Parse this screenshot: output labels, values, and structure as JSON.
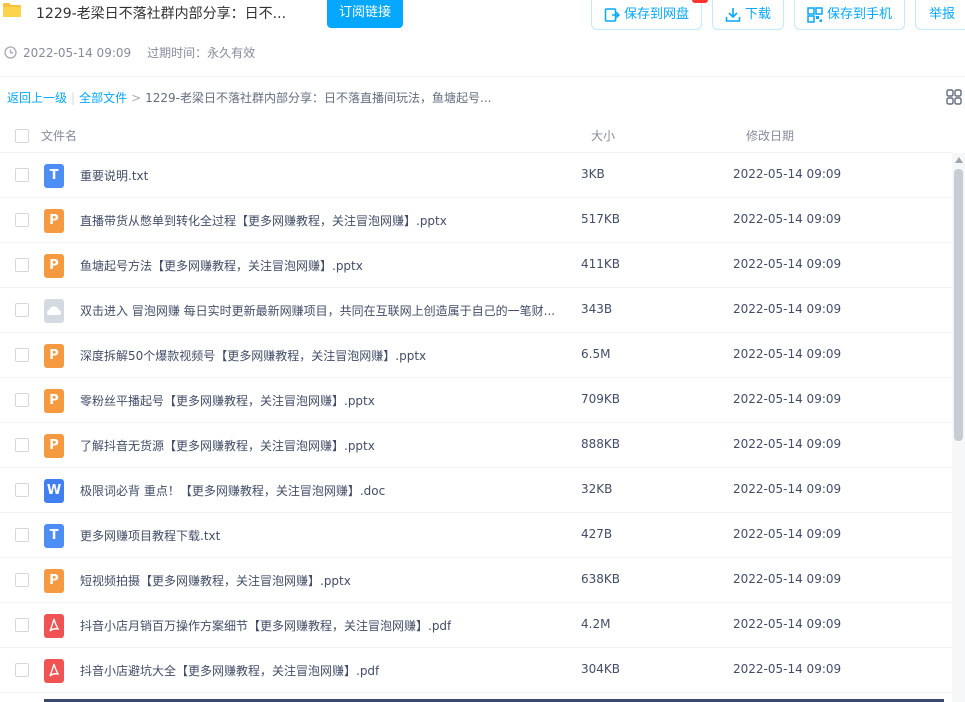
{
  "header": {
    "title": "1229-老梁日不落社群内部分享：日不...",
    "subscribe_label": "订阅链接",
    "save_label": "保存到网盘",
    "download_label": "下载",
    "phone_label": "保存到手机",
    "report_label": "举报"
  },
  "meta": {
    "date": "2022-05-14 09:09",
    "expire": "过期时间：永久有效"
  },
  "breadcrumb": {
    "back": "返回上一级",
    "all": "全部文件",
    "sep": ">",
    "current": "1229-老梁日不落社群内部分享：日不落直播间玩法，鱼塘起号..."
  },
  "table": {
    "headers": {
      "name": "文件名",
      "size": "大小",
      "date": "修改日期"
    },
    "rows": [
      {
        "icon": "t",
        "glyph": "T",
        "name": "重要说明.txt",
        "size": "3KB",
        "date": "2022-05-14 09:09"
      },
      {
        "icon": "p",
        "glyph": "P",
        "name": "直播带货从憋单到转化全过程【更多网赚教程，关注冒泡网赚】.pptx",
        "size": "517KB",
        "date": "2022-05-14 09:09"
      },
      {
        "icon": "p",
        "glyph": "P",
        "name": "鱼塘起号方法【更多网赚教程，关注冒泡网赚】.pptx",
        "size": "411KB",
        "date": "2022-05-14 09:09"
      },
      {
        "icon": "cloud",
        "glyph": "",
        "name": "双击进入 冒泡网赚 每日实时更新最新网赚项目，共同在互联网上创造属于自己的一笔财...",
        "size": "343B",
        "date": "2022-05-14 09:09"
      },
      {
        "icon": "p",
        "glyph": "P",
        "name": "深度拆解50个爆款视频号【更多网赚教程，关注冒泡网赚】.pptx",
        "size": "6.5M",
        "date": "2022-05-14 09:09"
      },
      {
        "icon": "p",
        "glyph": "P",
        "name": "零粉丝平播起号【更多网赚教程，关注冒泡网赚】.pptx",
        "size": "709KB",
        "date": "2022-05-14 09:09"
      },
      {
        "icon": "p",
        "glyph": "P",
        "name": "了解抖音无货源【更多网赚教程，关注冒泡网赚】.pptx",
        "size": "888KB",
        "date": "2022-05-14 09:09"
      },
      {
        "icon": "w",
        "glyph": "W",
        "name": "极限词必背 重点！【更多网赚教程，关注冒泡网赚】.doc",
        "size": "32KB",
        "date": "2022-05-14 09:09"
      },
      {
        "icon": "t",
        "glyph": "T",
        "name": "更多网赚项目教程下载.txt",
        "size": "427B",
        "date": "2022-05-14 09:09"
      },
      {
        "icon": "p",
        "glyph": "P",
        "name": "短视频拍摄【更多网赚教程，关注冒泡网赚】.pptx",
        "size": "638KB",
        "date": "2022-05-14 09:09"
      },
      {
        "icon": "pdf",
        "glyph": "",
        "name": "抖音小店月销百万操作方案细节【更多网赚教程，关注冒泡网赚】.pdf",
        "size": "4.2M",
        "date": "2022-05-14 09:09"
      },
      {
        "icon": "pdf",
        "glyph": "",
        "name": "抖音小店避坑大全【更多网赚教程，关注冒泡网赚】.pdf",
        "size": "304KB",
        "date": "2022-05-14 09:09"
      }
    ]
  },
  "colors": {
    "accent": "#06a7ff",
    "ppt": "#f59a40",
    "txt": "#4d8ef5",
    "pdf": "#f05353"
  }
}
